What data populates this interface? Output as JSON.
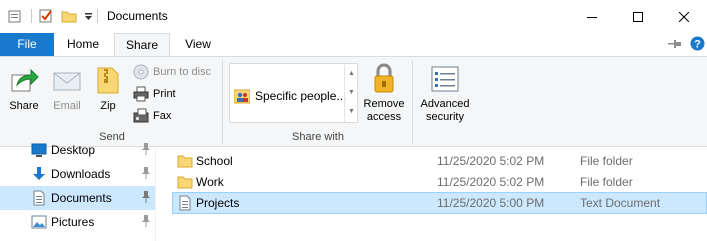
{
  "window": {
    "title": "Documents",
    "controls": [
      "minimize",
      "maximize",
      "close"
    ]
  },
  "quick_access": {
    "icons": [
      "app-icon",
      "properties-icon",
      "new-folder-icon",
      "customize-dropdown-icon"
    ]
  },
  "tabs": {
    "file": "File",
    "home": "Home",
    "share": "Share",
    "view": "View",
    "active": "Share"
  },
  "ribbon": {
    "send": {
      "share": "Share",
      "email": "Email",
      "zip": "Zip",
      "burn": "Burn to disc",
      "print": "Print",
      "fax": "Fax",
      "group_label": "Send"
    },
    "share_with": {
      "selected_item": "Specific people...",
      "group_label": "Share with"
    },
    "remove_access": {
      "line1": "Remove",
      "line2": "access"
    },
    "advanced_security": {
      "line1": "Advanced",
      "line2": "security"
    }
  },
  "nav": {
    "items": [
      {
        "label": "Desktop",
        "pinned": true
      },
      {
        "label": "Downloads",
        "pinned": true
      },
      {
        "label": "Documents",
        "pinned": true
      },
      {
        "label": "Pictures",
        "pinned": true
      }
    ],
    "selected": "Documents"
  },
  "files": [
    {
      "name": "School",
      "date": "11/25/2020 5:02 PM",
      "type": "File folder"
    },
    {
      "name": "Work",
      "date": "11/25/2020 5:02 PM",
      "type": "File folder"
    },
    {
      "name": "Projects",
      "date": "11/25/2020 5:00 PM",
      "type": "Text Document"
    }
  ],
  "colors": {
    "accent": "#1979ca",
    "ribbon_bg": "#f5f6f7",
    "selection": "#cce8ff",
    "folder": "#f8d775",
    "help": "#1979ca"
  }
}
